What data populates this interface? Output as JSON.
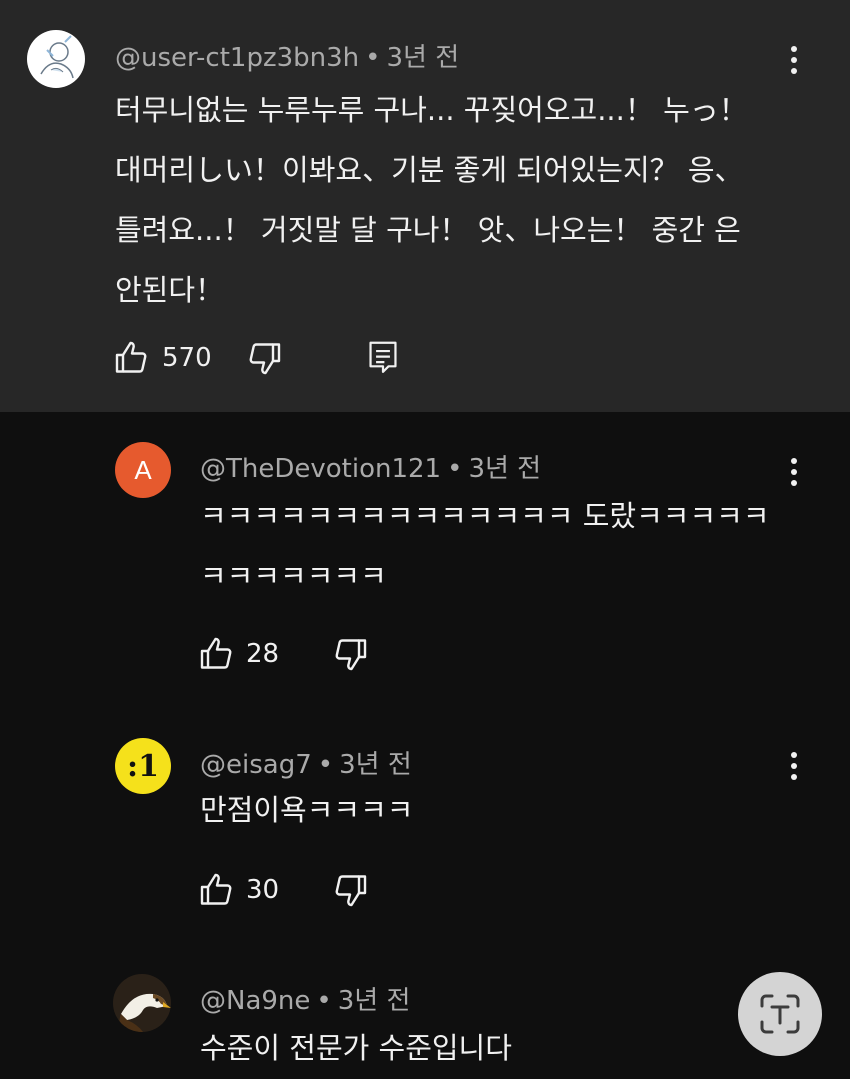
{
  "comments": [
    {
      "username": "@user-ct1pz3bn3h",
      "time": "3년 전",
      "lines": [
        "터무니없는 누루누루 구나... 꾸짖어오고...！ 누っ！",
        "대머리しい！이봐요、기분 좋게 되어있는지？ 응、",
        "틀려요...！ 거짓말 달 구나！ 앗、나오는！  중간 은",
        "안된다！"
      ],
      "likes": "570",
      "avatar_icon": "sketch-avatar-icon"
    },
    {
      "username": "@TheDevotion121",
      "time": "3년 전",
      "avatar_letter": "A",
      "avatar_color": "#e65a2e",
      "lines": [
        "ㅋㅋㅋㅋㅋㅋㅋㅋㅋㅋㅋㅋㅋㅋ 도랐ㅋㅋㅋㅋㅋ",
        "ㅋㅋㅋㅋㅋㅋㅋ"
      ],
      "likes": "28"
    },
    {
      "username": "@eisag7",
      "time": "3년 전",
      "avatar_text": ":1",
      "avatar_color": "#f5e11b",
      "lines": [
        "만점이욕ㅋㅋㅋㅋ"
      ],
      "likes": "30"
    },
    {
      "username": "@Na9ne",
      "time": "3년 전",
      "avatar_icon": "eagle-avatar-icon",
      "lines": [
        "수준이 전문가 수준입니다"
      ]
    }
  ],
  "icons": {
    "like": "thumbs-up-icon",
    "dislike": "thumbs-down-icon",
    "reply": "reply-icon",
    "more": "more-vertical-icon",
    "lens": "google-lens-icon"
  },
  "colors": {
    "background": "#0f0f0f",
    "highlighted_background": "#272727",
    "meta_text": "#aaaaaa"
  }
}
